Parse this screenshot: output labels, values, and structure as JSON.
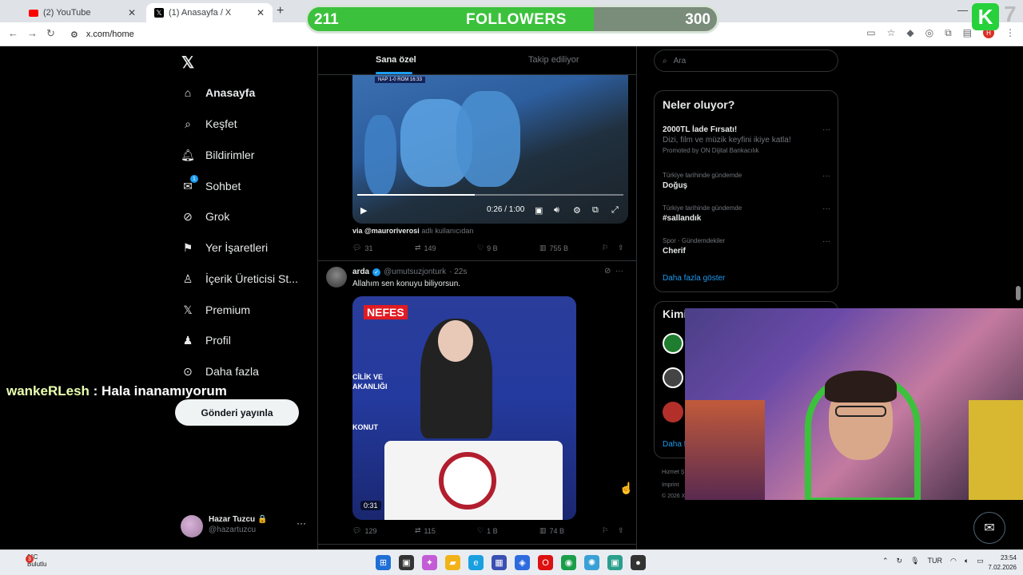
{
  "browser": {
    "tabs": [
      {
        "label": "(2) YouTube"
      },
      {
        "label": "(1) Anasayfa / X"
      }
    ],
    "url": "x.com/home",
    "profile_initial": "H"
  },
  "overlay": {
    "current": "211",
    "label": "FOLLOWERS",
    "goal": "300",
    "progress_fraction": 0.7,
    "logo_letter": "K",
    "side_number": "7"
  },
  "sidebar": {
    "items": [
      {
        "label": "Anasayfa",
        "icon": "home-icon"
      },
      {
        "label": "Keşfet",
        "icon": "search-icon"
      },
      {
        "label": "Bildirimler",
        "icon": "bell-icon"
      },
      {
        "label": "Sohbet",
        "icon": "mail-icon",
        "badge": "1"
      },
      {
        "label": "Grok",
        "icon": "grok-icon"
      },
      {
        "label": "Yer İşaretleri",
        "icon": "bookmark-icon"
      },
      {
        "label": "İçerik Üreticisi St...",
        "icon": "creator-icon"
      },
      {
        "label": "Premium",
        "icon": "x-icon"
      },
      {
        "label": "Profil",
        "icon": "person-icon"
      },
      {
        "label": "Daha fazla",
        "icon": "more-icon"
      }
    ],
    "post_button": "Gönderi yayınla",
    "profile": {
      "name": "Hazar Tuzcu 🔒",
      "handle": "@hazartuzcu"
    }
  },
  "chat": {
    "user": "wankeRLesh",
    "text": " : Hala inanamıyorum"
  },
  "feed": {
    "tabs": [
      "Sana özel",
      "Takip ediliyor"
    ],
    "post1": {
      "score": "NAP 1-0 ROM 16:33",
      "time": "0:26 / 1:00",
      "via_user": "via @mauroriverosi",
      "via_suffix": " adlı kullanıcıdan",
      "replies": "31",
      "reposts": "149",
      "likes": "9 B",
      "views": "755 B"
    },
    "post2": {
      "name": "arda",
      "handle": "@umutsuzjonturk",
      "age": "· 22s",
      "text": "Allahım sen konuyu biliyorsun.",
      "video_badge": "NEFES",
      "video_caption": "CİLİK VE\nAKANLIĞI",
      "video_caption2": "KONUT",
      "duration": "0:31",
      "replies": "129",
      "reposts": "115",
      "likes": "1 B",
      "views": "74 B"
    }
  },
  "right": {
    "search_placeholder": "Ara",
    "trends_title": "Neler oluyor?",
    "promo": {
      "title": "2000TL İade Fırsatı!",
      "desc": "Dizi, film ve müzik keyfini ikiye katla!",
      "by": "Promoted by ON Dijital Bankacılık"
    },
    "trends": [
      {
        "meta": "Türkiye tarihinde gündemde",
        "name": "Doğuş"
      },
      {
        "meta": "Türkiye tarihinde gündemde",
        "name": "#sallandık"
      },
      {
        "meta": "Spor · Gündemdekiler",
        "name": "Cherif"
      }
    ],
    "show_more": "Daha fazla göster",
    "who_title": "Kimi",
    "who_more": "Daha f",
    "footer1": "Hizmet Ş",
    "footer2": "Imprint",
    "footer3": "© 2026 X"
  },
  "taskbar": {
    "weather_temp": "9°C",
    "weather_text": "Bulutlu",
    "weather_badge": "3",
    "lang": "TUR",
    "time": "23:54",
    "date": "7.02.2026"
  }
}
